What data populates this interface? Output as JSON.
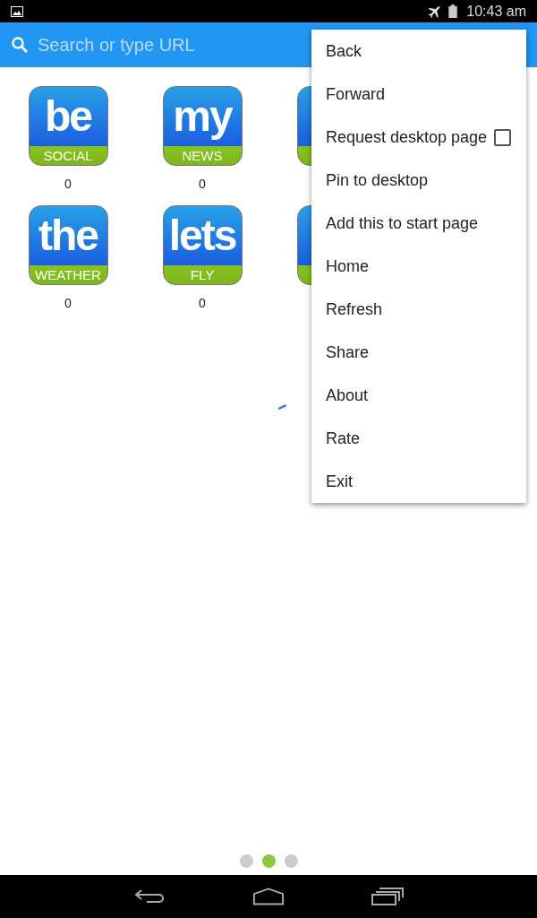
{
  "status_bar": {
    "time": "10:43 am"
  },
  "search": {
    "placeholder": "Search or type URL"
  },
  "apps": [
    {
      "kind": "app",
      "word": "be",
      "label": "SOCIAL",
      "count": "0"
    },
    {
      "kind": "app",
      "word": "my",
      "label": "NEWS",
      "count": "0"
    },
    {
      "kind": "covered"
    },
    {
      "kind": "app",
      "word": "the",
      "label": "WEATHER",
      "count": "0"
    },
    {
      "kind": "app",
      "word": "lets",
      "label": "FLY",
      "count": "0"
    },
    {
      "kind": "covered"
    }
  ],
  "menu": [
    {
      "label": "Back"
    },
    {
      "label": "Forward"
    },
    {
      "label": "Request desktop page",
      "kind": "checkbox",
      "checked": false
    },
    {
      "label": "Pin to desktop"
    },
    {
      "label": "Add this to start page"
    },
    {
      "label": "Home"
    },
    {
      "label": "Refresh"
    },
    {
      "label": "Share"
    },
    {
      "label": "About"
    },
    {
      "label": "Rate"
    },
    {
      "label": "Exit"
    }
  ],
  "pages": [
    {
      "selected": false
    },
    {
      "selected": true
    },
    {
      "selected": false
    }
  ]
}
